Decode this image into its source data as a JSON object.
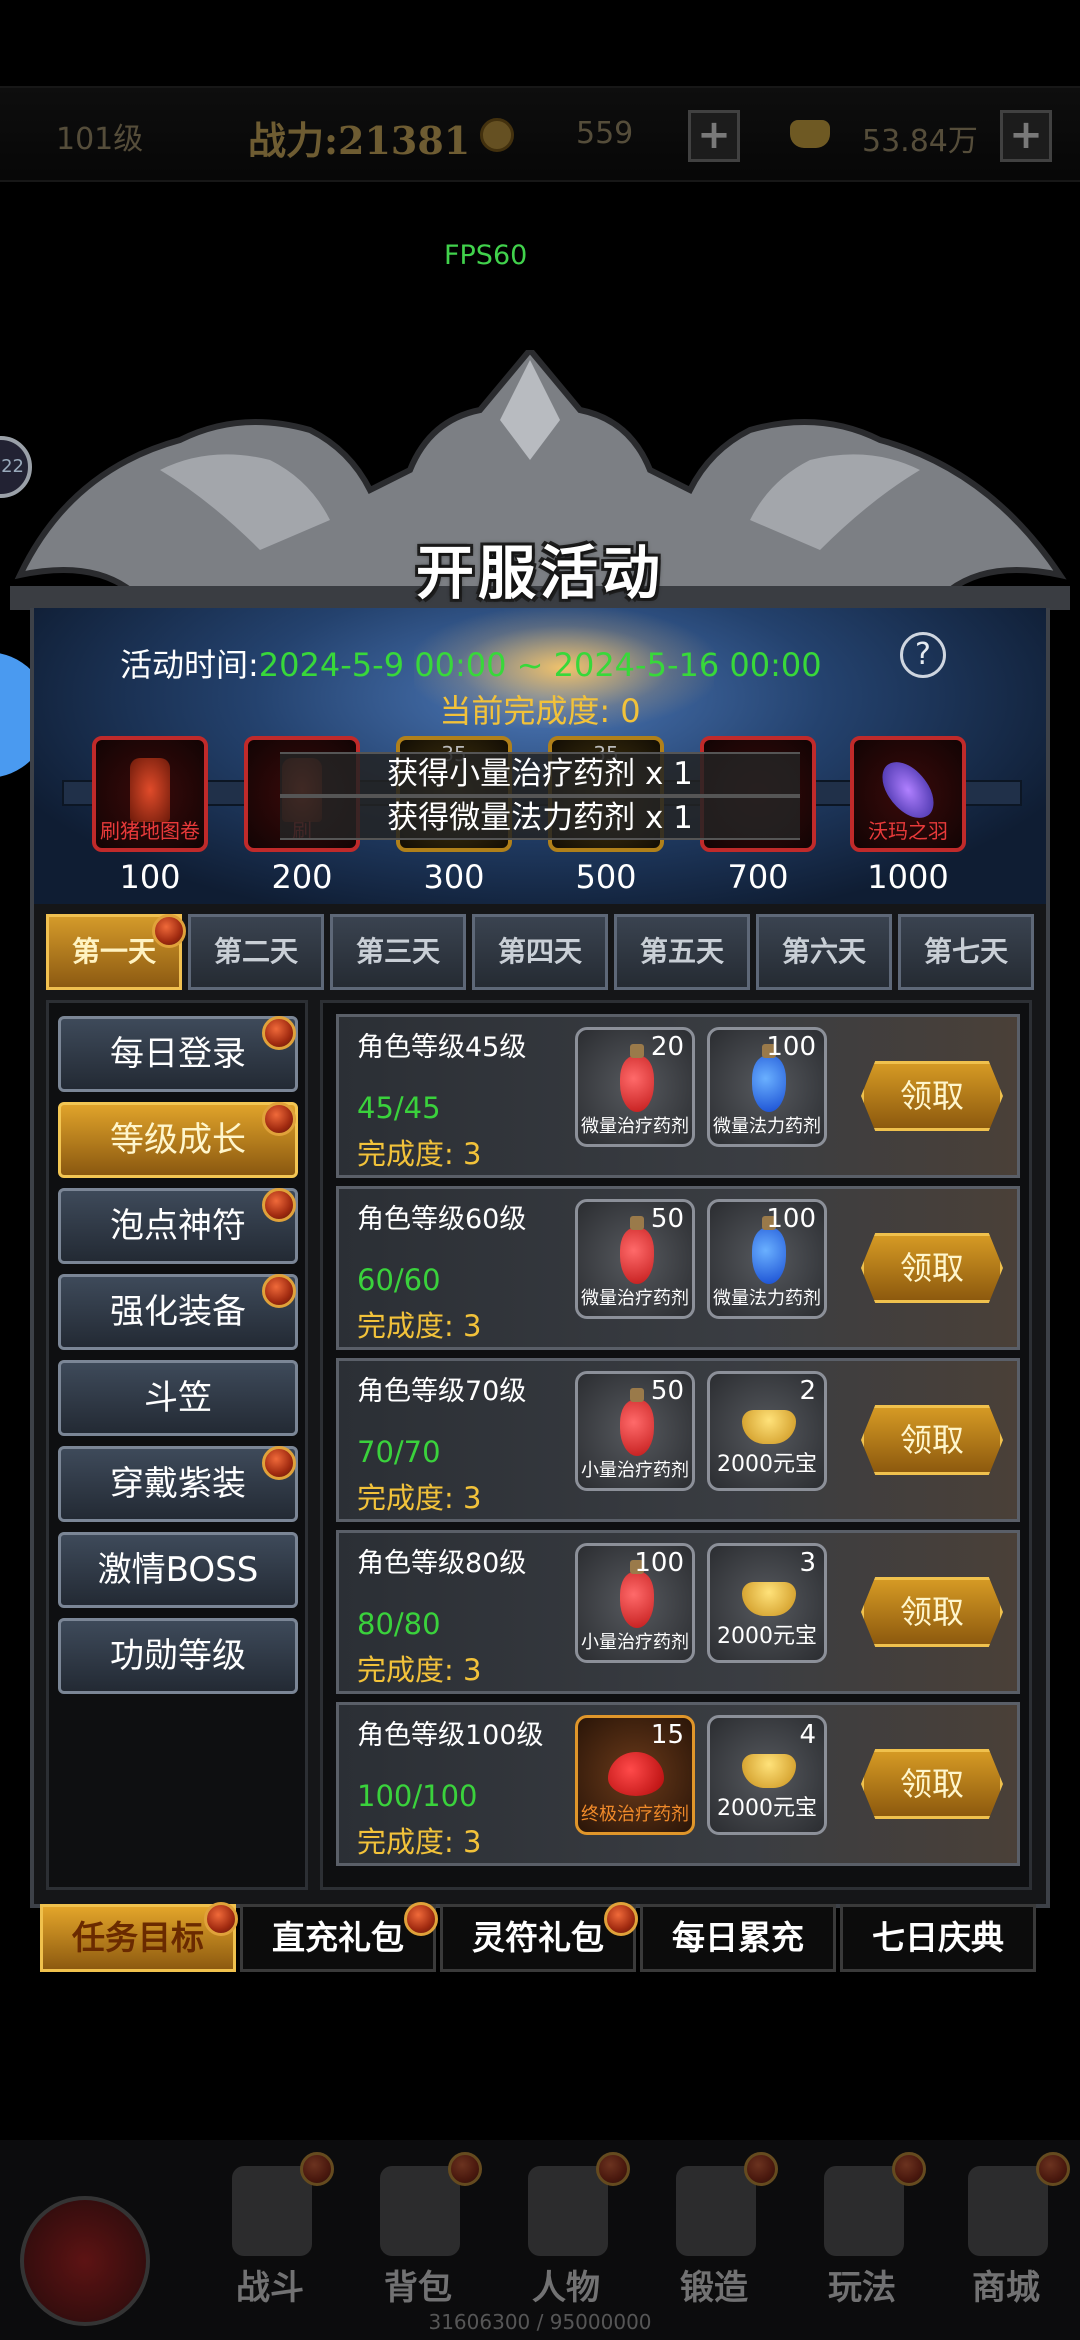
{
  "top_bar": {
    "level": "101级",
    "power": "战力:21381",
    "coins": "559",
    "gold": "53.84万",
    "plus_icon": "plus-icon",
    "coin_icon": "coin-icon",
    "gold_icon": "gold-ingot-icon"
  },
  "fps": "FPS60",
  "side_ring_text": "22",
  "panel": {
    "title": "开服活动",
    "time_label": "活动时间:",
    "time_value": "2024-5-9 00:00 ~ 2024-5-16 00:00",
    "progress_label": "当前完成度: 0",
    "help": "?"
  },
  "milestones": [
    {
      "name": "刷猪地图卷",
      "value": "100"
    },
    {
      "name": "刷",
      "value": "200"
    },
    {
      "name": "",
      "value": "300"
    },
    {
      "name": "",
      "value": "500"
    },
    {
      "name": "",
      "value": "700"
    },
    {
      "name": "沃玛之羽",
      "value": "1000"
    }
  ],
  "milestone_ghost_digits": [
    "35",
    "35"
  ],
  "toasts": [
    "获得小量治疗药剂 x 1",
    "获得微量法力药剂 x 1"
  ],
  "day_tabs": [
    "第一天",
    "第二天",
    "第三天",
    "第四天",
    "第五天",
    "第六天",
    "第七天"
  ],
  "active_day": 0,
  "sidebar": [
    "每日登录",
    "等级成长",
    "泡点神符",
    "强化装备",
    "斗笠",
    "穿戴紫装",
    "激情BOSS",
    "功勋等级"
  ],
  "active_sidebar": 1,
  "tasks": [
    {
      "name": "角色等级45级",
      "progress": "45/45",
      "done": "完成度: 3",
      "items": [
        {
          "count": "20",
          "name": "微量治疗药剂",
          "icon": "red-potion-icon"
        },
        {
          "count": "100",
          "name": "微量法力药剂",
          "icon": "blue-potion-icon"
        }
      ],
      "claim": "领取"
    },
    {
      "name": "角色等级60级",
      "progress": "60/60",
      "done": "完成度: 3",
      "items": [
        {
          "count": "50",
          "name": "微量治疗药剂",
          "icon": "red-potion-icon"
        },
        {
          "count": "100",
          "name": "微量法力药剂",
          "icon": "blue-potion-icon"
        }
      ],
      "claim": "领取"
    },
    {
      "name": "角色等级70级",
      "progress": "70/70",
      "done": "完成度: 3",
      "items": [
        {
          "count": "50",
          "name": "小量治疗药剂",
          "icon": "red-potion-icon"
        },
        {
          "count": "2",
          "name": "2000元宝",
          "icon": "gold-ingot-icon"
        }
      ],
      "claim": "领取"
    },
    {
      "name": "角色等级80级",
      "progress": "80/80",
      "done": "完成度: 3",
      "items": [
        {
          "count": "100",
          "name": "小量治疗药剂",
          "icon": "red-potion-icon"
        },
        {
          "count": "3",
          "name": "2000元宝",
          "icon": "gold-ingot-icon"
        }
      ],
      "claim": "领取"
    },
    {
      "name": "角色等级100级",
      "progress": "100/100",
      "done": "完成度: 3",
      "items": [
        {
          "count": "15",
          "name": "终极治疗药剂",
          "icon": "heart-potion-icon"
        },
        {
          "count": "4",
          "name": "2000元宝",
          "icon": "gold-ingot-icon"
        }
      ],
      "claim": "领取"
    }
  ],
  "bottom_tabs": [
    "任务目标",
    "直充礼包",
    "灵符礼包",
    "每日累充",
    "七日庆典"
  ],
  "active_bottom_tab": 0,
  "nav": [
    "战斗",
    "背包",
    "人物",
    "锻造",
    "玩法",
    "商城"
  ],
  "xp": "31606300 / 95000000",
  "colors": {
    "accent_gold": "#f2c23a",
    "progress_green": "#3ad23c",
    "milestone_red": "#c02a2a"
  }
}
